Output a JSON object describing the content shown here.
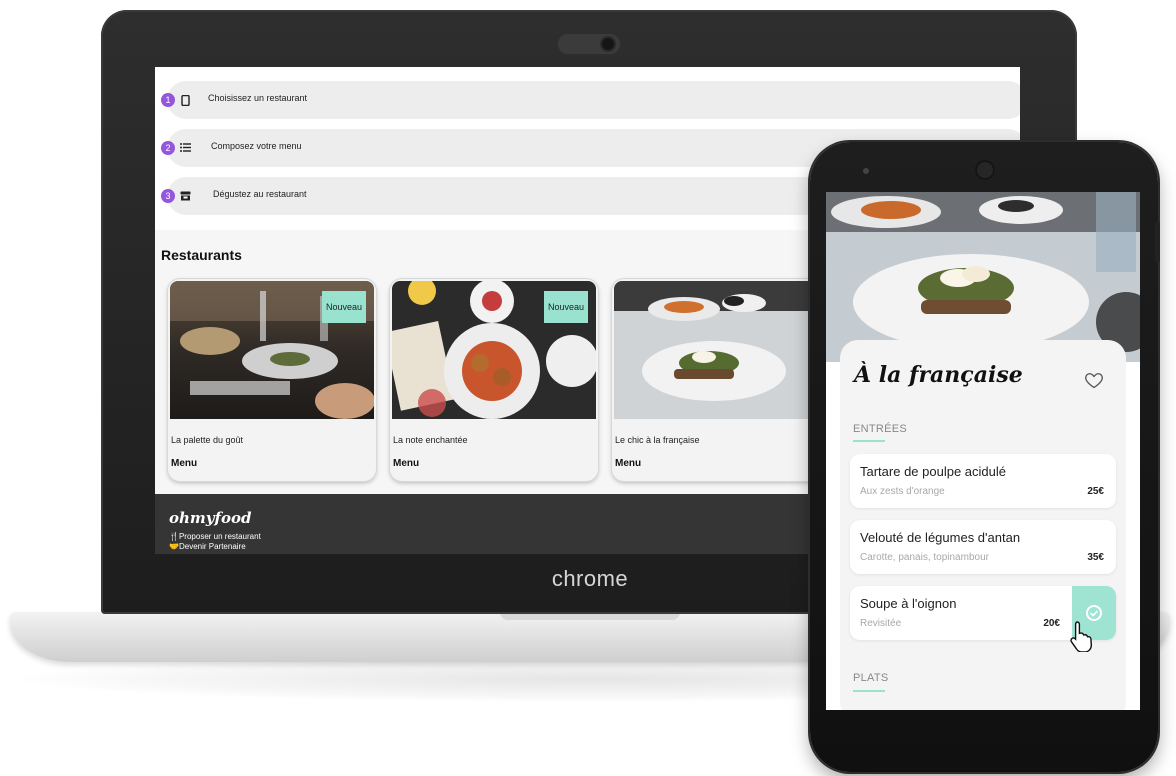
{
  "laptop": {
    "brand_label": "chrome",
    "steps": [
      {
        "number": "1",
        "icon": "phone-icon",
        "label": "Choisissez un restaurant"
      },
      {
        "number": "2",
        "icon": "list-icon",
        "label": "Composez votre menu"
      },
      {
        "number": "3",
        "icon": "store-icon",
        "label": "Dégustez au restaurant"
      }
    ],
    "restaurants_title": "Restaurants",
    "cards": [
      {
        "name": "La palette du goût",
        "menu_label": "Menu",
        "badge": "Nouveau"
      },
      {
        "name": "La note enchantée",
        "menu_label": "Menu",
        "badge": "Nouveau"
      },
      {
        "name": "Le chic à la française",
        "menu_label": "Menu",
        "badge": ""
      }
    ],
    "footer": {
      "logo": "ohmyfood",
      "links": [
        {
          "icon": "cutlery-icon",
          "label": "Proposer un restaurant"
        },
        {
          "icon": "handshake-icon",
          "label": "Devenir Partenaire"
        }
      ]
    }
  },
  "phone": {
    "title": "À la française",
    "sections": [
      {
        "label": "ENTRÉES",
        "dishes": [
          {
            "name": "Tartare de poulpe acidulé",
            "description": "Aux zests d'orange",
            "price": "25€"
          },
          {
            "name": "Velouté de légumes d'antan",
            "description": "Carotte, panais, topinambour",
            "price": "35€"
          },
          {
            "name": "Soupe à l'oignon",
            "description": "Revisitée",
            "price": "20€"
          }
        ]
      },
      {
        "label": "PLATS",
        "dishes": []
      }
    ]
  },
  "colors": {
    "accent_purple": "#9356dc",
    "accent_mint": "#99e2d0",
    "footer_bg": "#353535"
  }
}
